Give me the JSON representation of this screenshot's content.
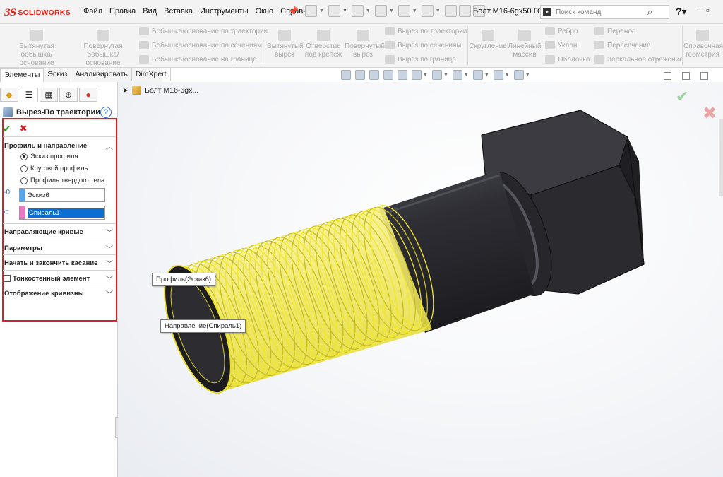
{
  "app": {
    "brand_ds": "3S",
    "brand_name": "SOLIDWORKS",
    "document_title": "Болт М16-6gx50 ГО...",
    "search_placeholder": "Поиск команд"
  },
  "menu": [
    "Файл",
    "Правка",
    "Вид",
    "Вставка",
    "Инструменты",
    "Окно",
    "Справка"
  ],
  "command_manager": {
    "extruded_boss": "Вытянутая бобышка/основание",
    "revolved_boss": "Повернутая бобышка/основание",
    "swept_boss": "Бобышка/основание по траектории",
    "lofted_boss": "Бобышка/основание по сечениям",
    "boundary_boss": "Бобышка/основание на границе",
    "extruded_cut": "Вытянутый вырез",
    "hole_wizard": "Отверстие под крепеж",
    "revolved_cut": "Повернутый вырез",
    "swept_cut": "Вырез по траектории",
    "lofted_cut": "Вырез по сечениям",
    "boundary_cut": "Вырез по границе",
    "fillet": "Скругление",
    "linear_pattern": "Линейный массив",
    "rib": "Ребро",
    "draft": "Уклон",
    "shell": "Оболочка",
    "wrap": "Перенос",
    "intersect": "Пересечение",
    "mirror": "Зеркальное отражение",
    "ref_geometry": "Справочная геометрия"
  },
  "tabs": [
    "Элементы",
    "Эскиз",
    "Анализировать",
    "DimXpert"
  ],
  "property_manager": {
    "feature_title": "Вырез-По траектории",
    "help": "?",
    "ok": "✔",
    "cancel": "✖",
    "section_profile": "Профиль и направление",
    "radio_sketch_profile": "Эскиз профиля",
    "radio_circular_profile": "Круговой профиль",
    "radio_solid_profile": "Профиль твердого тела",
    "profile_value": "Эскиз6",
    "path_value": "Спираль1",
    "section_guides": "Направляющие кривые",
    "section_params": "Параметры",
    "section_tangency": "Начать и закончить касание",
    "section_thin": "Тонкостенный элемент",
    "section_curvature": "Отображение кривизны"
  },
  "viewport": {
    "tree_root": "Болт М16-6gx...",
    "callout_profile": "Профиль(Эскиз6)",
    "callout_path": "Направление(Спираль1)"
  },
  "colors": {
    "accent_red": "#d2232a",
    "helix_yellow": "#f0e62a",
    "selection_blue": "#0a6fd1",
    "bolt_dark": "#2b2b30"
  }
}
